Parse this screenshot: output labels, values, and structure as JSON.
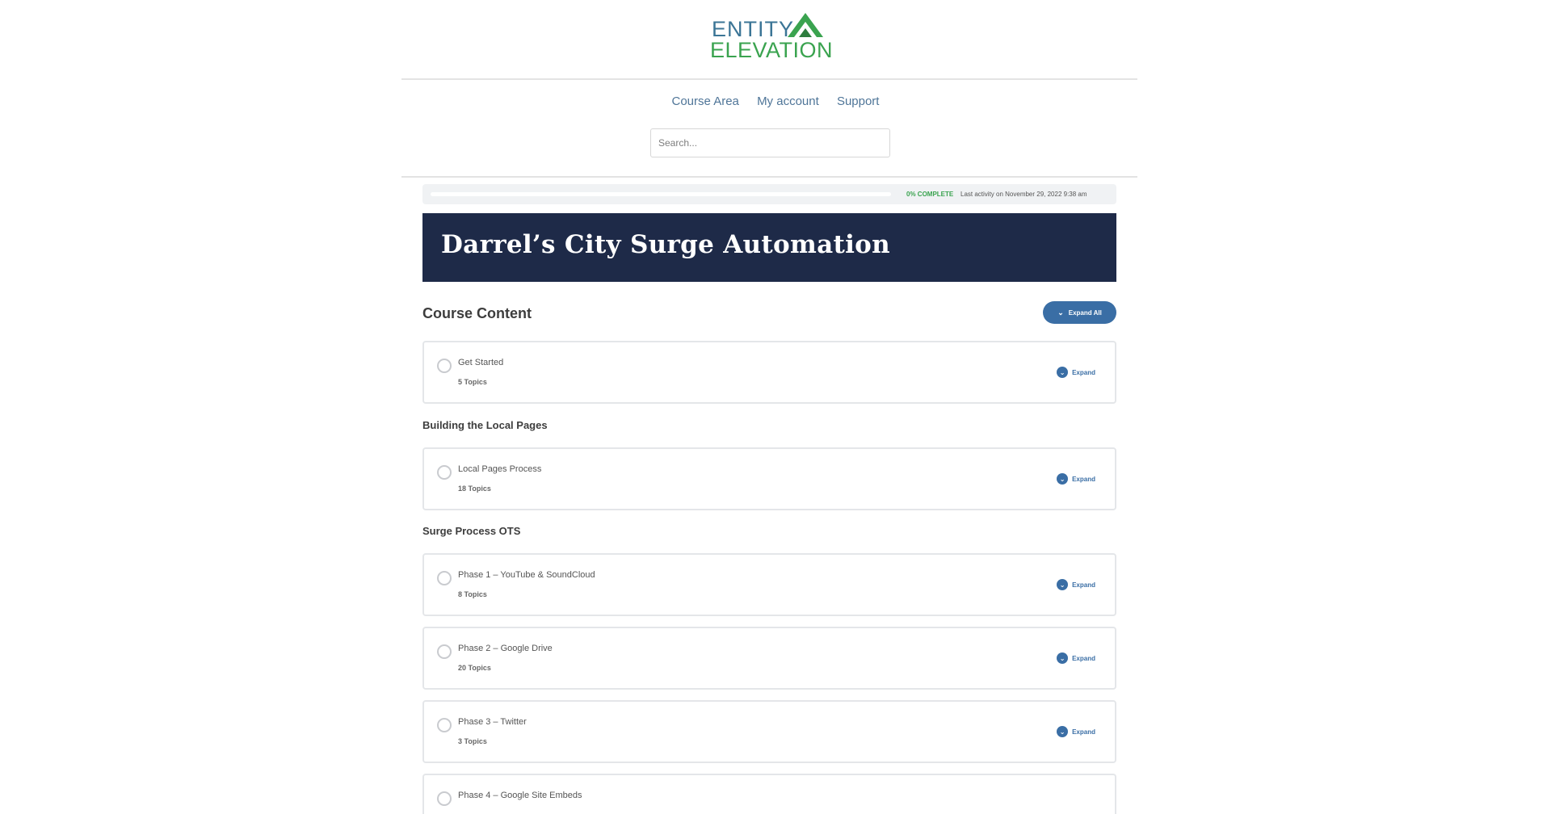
{
  "brand": {
    "line1": "ENTITY",
    "line2": "ELEVATION",
    "colors": {
      "blue": "#3b7596",
      "green": "#3aa34f"
    }
  },
  "nav": {
    "items": [
      "Course Area",
      "My account",
      "Support"
    ]
  },
  "search": {
    "placeholder": "Search..."
  },
  "progress": {
    "percent": 0,
    "label": "0% COMPLETE",
    "activity": "Last activity on November 29, 2022 9:38 am"
  },
  "course": {
    "title": "Darrel’s City Surge Automation",
    "content_heading": "Course Content",
    "expand_all_label": "Expand All",
    "expand_label": "Expand"
  },
  "sections": [
    {
      "heading": "",
      "lessons": [
        {
          "title": "Get Started",
          "topics": "5 Topics"
        }
      ]
    },
    {
      "heading": "Building the Local Pages",
      "lessons": [
        {
          "title": "Local Pages Process",
          "topics": "18 Topics"
        }
      ]
    },
    {
      "heading": "Surge Process OTS",
      "lessons": [
        {
          "title": "Phase 1 – YouTube & SoundCloud",
          "topics": "8 Topics"
        },
        {
          "title": "Phase 2 – Google Drive",
          "topics": "20 Topics"
        },
        {
          "title": "Phase 3 – Twitter",
          "topics": "3 Topics"
        },
        {
          "title": "Phase 4 – Google Site Embeds",
          "topics": ""
        }
      ]
    }
  ],
  "theme": {
    "banner": "#1e2a48",
    "accent": "#3a6ea5"
  }
}
